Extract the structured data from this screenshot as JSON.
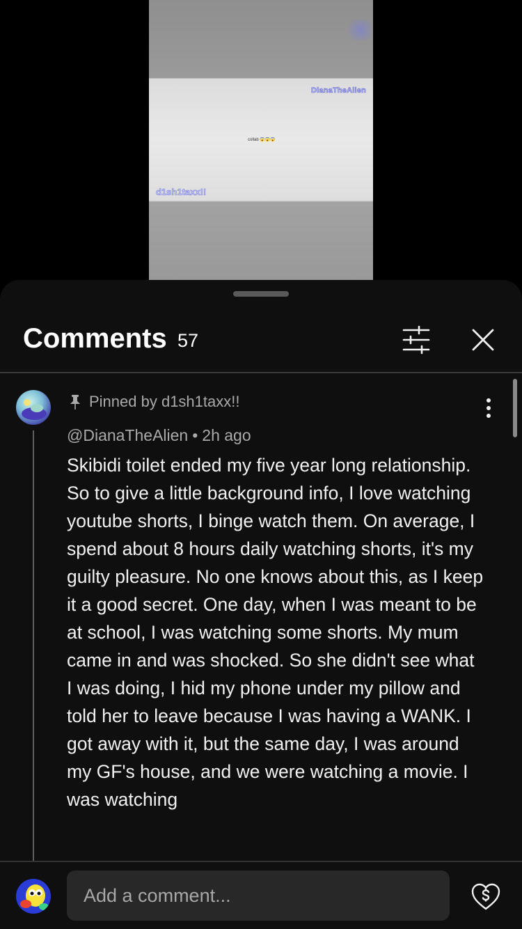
{
  "video": {
    "watermark_top": "DianaTheAlien",
    "caption": "collab",
    "caption_emoji": "😱😱😱",
    "watermark_bottom": "d1sh1taxx!!"
  },
  "comments_panel": {
    "title": "Comments",
    "count": "57",
    "icons": {
      "filter": "filter-sliders-icon",
      "close": "close-icon",
      "pin": "pin-icon",
      "more": "more-vertical-icon",
      "thanks": "super-thanks-heart-dollar-icon"
    }
  },
  "pinned_comment": {
    "pinned_label": "Pinned by d1sh1taxx!!",
    "author": "@DianaTheAlien",
    "separator": "•",
    "time": "2h ago",
    "text": "Skibidi toilet ended my five year long relationship.\nSo to give a little background info, I love watching youtube shorts, I binge watch them. On average, I spend about 8 hours daily watching shorts, it's my guilty pleasure. No one knows about this, as I keep it a good secret. One day, when I was meant to be at school, I was watching some shorts. My mum came in and was shocked. So she didn't see what I was doing, I hid my phone under my pillow and told her to leave because I was having a WANK. I got away with it, but the same day, I was around my GF's house, and we were watching a movie. I was watching"
  },
  "composer": {
    "placeholder": "Add a comment..."
  },
  "colors": {
    "sheet_bg": "#0f0f0f",
    "secondary_text": "#aaaaaa",
    "input_bg": "#282828"
  }
}
